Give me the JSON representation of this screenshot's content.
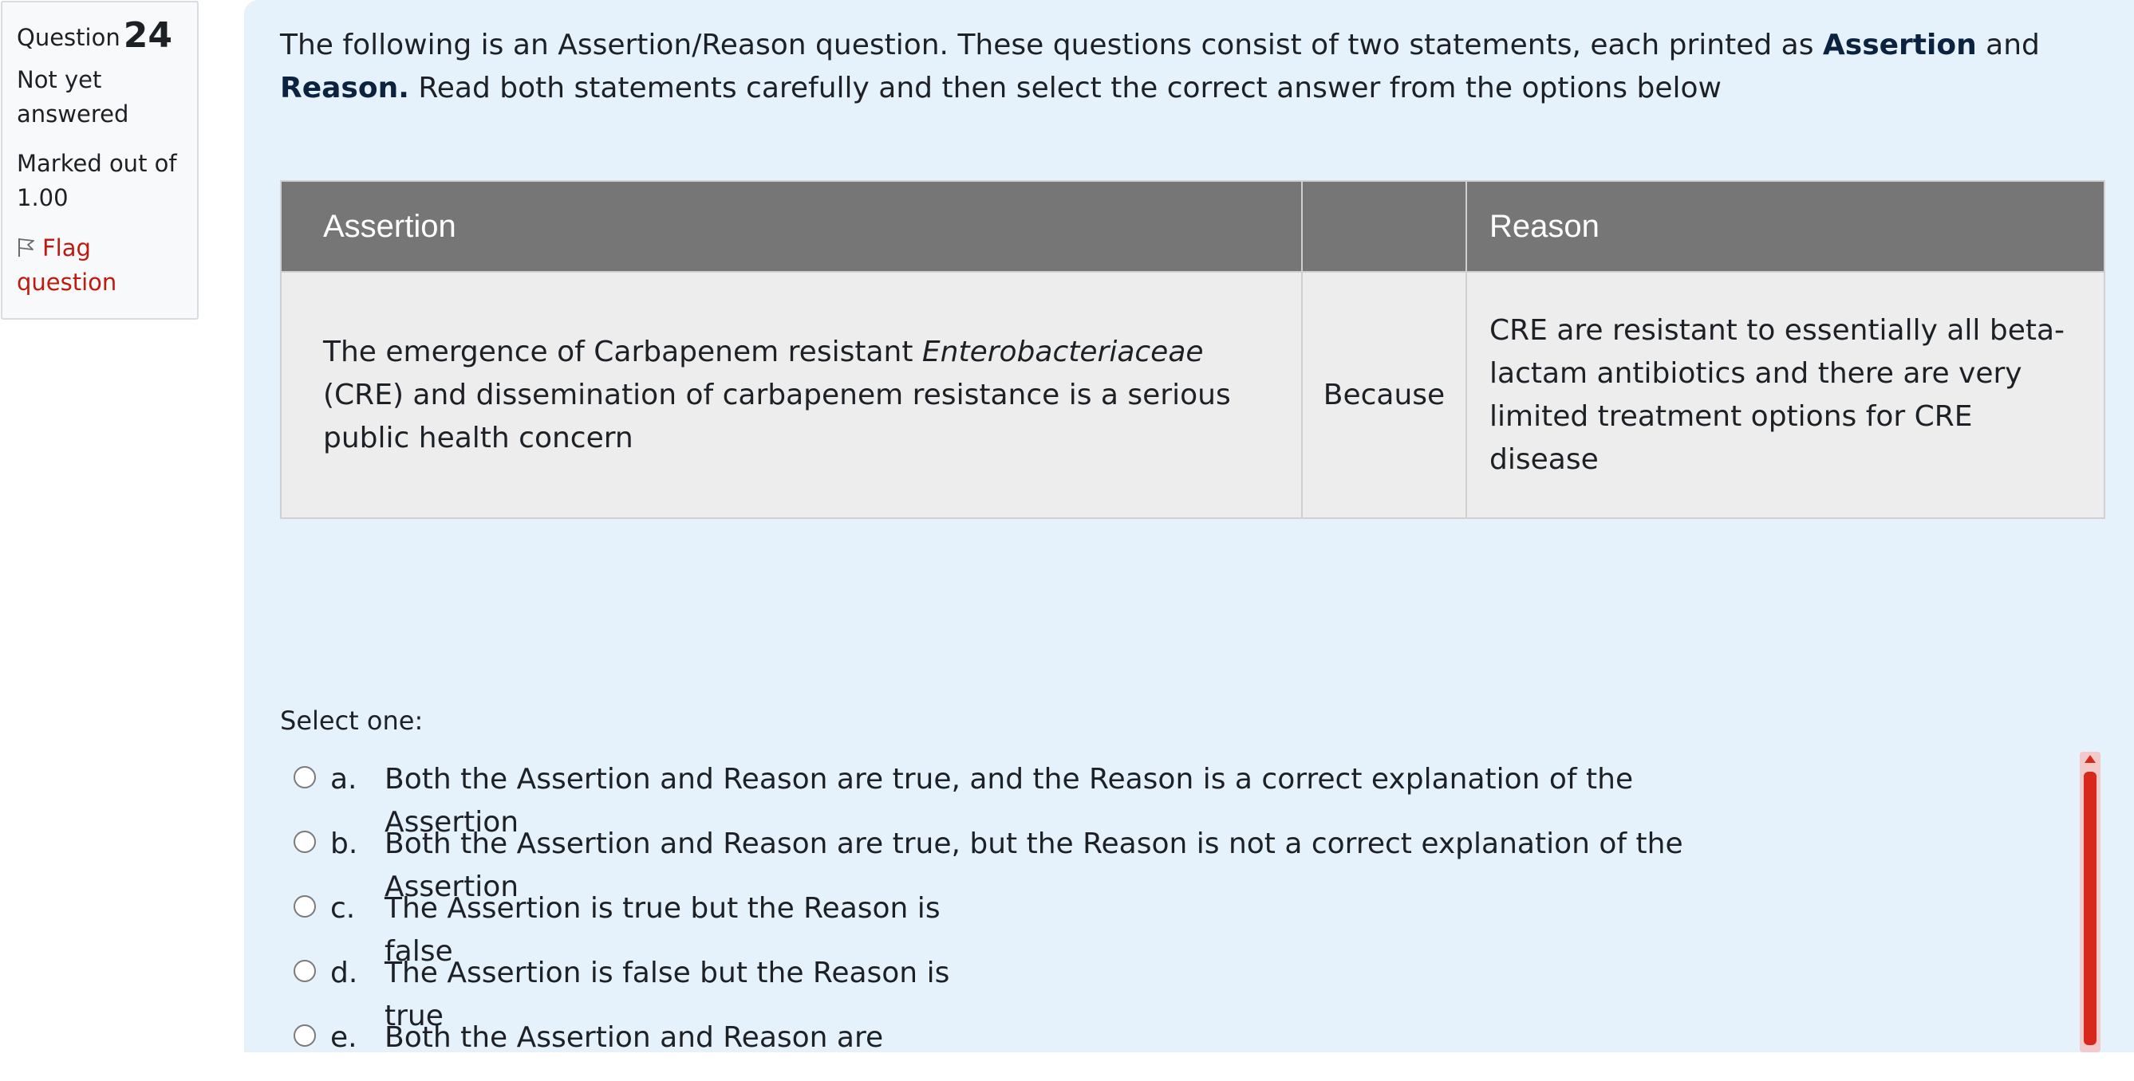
{
  "info": {
    "question_label": "Question",
    "question_number": "24",
    "state": "Not yet answered",
    "grade": "Marked out of 1.00",
    "flag_label": "Flag question",
    "flag_icon": "flag-icon"
  },
  "intro": {
    "part1": "The following is an Assertion/Reason question.  These questions consist of two statements, each printed as ",
    "bold1": "Assertion",
    "part2": " and ",
    "bold2": "Reason.",
    "part3": " Read both statements carefully and then select the correct answer from the options below"
  },
  "table": {
    "header_assertion": "Assertion",
    "header_middle": "",
    "header_reason": "Reason",
    "assertion_part1": "The emergence of Carbapenem resistant ",
    "assertion_italic": "Enterobacteriaceae",
    "assertion_part2": " (CRE) and dissemination of carbapenem resistance is a serious public health concern",
    "connector": "Because",
    "reason": "CRE are resistant to essentially all beta-lactam antibiotics and there are very limited treatment options for CRE disease"
  },
  "answer": {
    "prompt": "Select one:",
    "options": [
      {
        "letter": "a.",
        "text": "Both the Assertion and Reason are true, and the Reason is a correct explanation of the Assertion",
        "selected": false
      },
      {
        "letter": "b.",
        "text": "Both the Assertion and Reason are true, but the Reason is not a correct explanation of the Assertion",
        "selected": false
      },
      {
        "letter": "c.",
        "text": "The Assertion is true but the Reason is false",
        "selected": false
      },
      {
        "letter": "d.",
        "text": "The Assertion is false but the Reason is true",
        "selected": false
      },
      {
        "letter": "e.",
        "text": "Both the Assertion and Reason are",
        "selected": false
      }
    ]
  },
  "colors": {
    "panel_bg": "#e5f2fc",
    "table_header_bg": "#767676",
    "table_cell_bg": "#ededed",
    "flag_link": "#c01a0f",
    "scrollbar_thumb": "#d8281e"
  }
}
